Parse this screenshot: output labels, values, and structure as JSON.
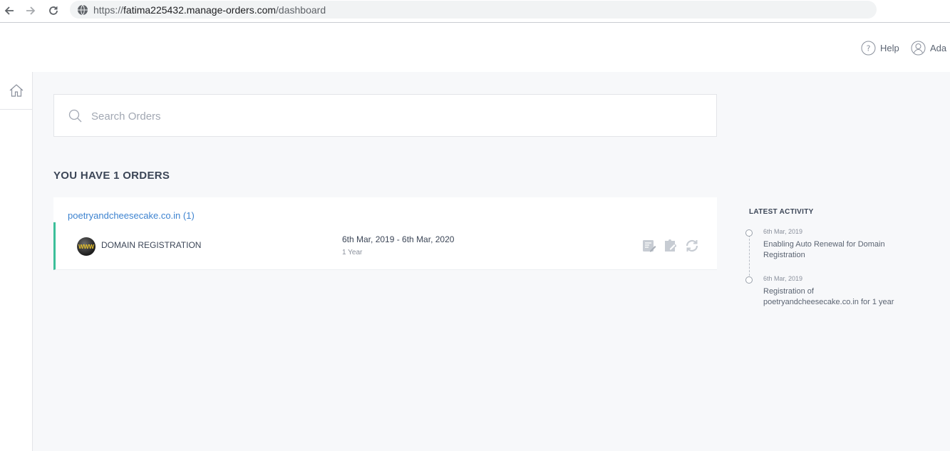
{
  "browser": {
    "url_prefix": "https://",
    "url_host": "fatima225432.manage-orders.com",
    "url_path": "/dashboard"
  },
  "header": {
    "help_label": "Help",
    "user_name": "Ada"
  },
  "search": {
    "placeholder": "Search Orders"
  },
  "orders": {
    "heading": "YOU HAVE 1 ORDERS",
    "items": [
      {
        "domain": "poetryandcheesecake.co.in (1)",
        "product": "DOMAIN REGISTRATION",
        "product_icon_text": "WWW",
        "dates": "6th Mar, 2019 - 6th Mar, 2020",
        "term": "1 Year"
      }
    ]
  },
  "activity": {
    "title": "LATEST ACTIVITY",
    "items": [
      {
        "date": "6th Mar, 2019",
        "text": "Enabling Auto Renewal for Domain Registration"
      },
      {
        "date": "6th Mar, 2019",
        "text": "Registration of poetryandcheesecake.co.in for 1 year"
      }
    ]
  },
  "colors": {
    "accent_link": "#3d83d0",
    "active_border": "#3cbf9a",
    "background": "#f7f8fa"
  }
}
